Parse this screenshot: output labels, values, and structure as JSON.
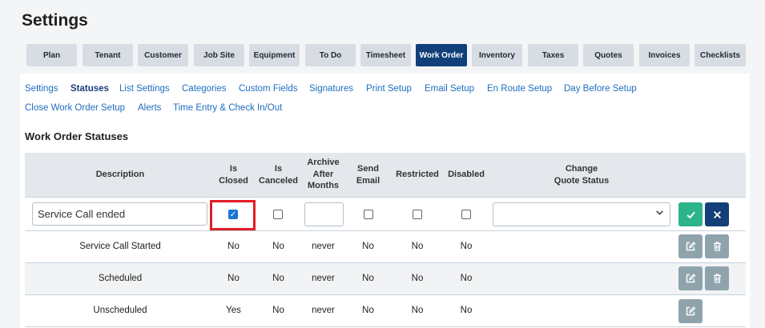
{
  "page": {
    "title": "Settings"
  },
  "tabs": [
    {
      "label": "Plan",
      "active": false
    },
    {
      "label": "Tenant",
      "active": false
    },
    {
      "label": "Customer",
      "active": false
    },
    {
      "label": "Job Site",
      "active": false
    },
    {
      "label": "Equipment",
      "active": false
    },
    {
      "label": "To Do",
      "active": false
    },
    {
      "label": "Timesheet",
      "active": false
    },
    {
      "label": "Work Order",
      "active": true
    },
    {
      "label": "Inventory",
      "active": false
    },
    {
      "label": "Taxes",
      "active": false
    },
    {
      "label": "Quotes",
      "active": false
    },
    {
      "label": "Invoices",
      "active": false
    },
    {
      "label": "Checklists",
      "active": false
    }
  ],
  "subnav": [
    {
      "label": "Settings",
      "active": false
    },
    {
      "label": "Statuses",
      "active": true
    },
    {
      "label": "List Settings",
      "active": false
    },
    {
      "label": "Categories",
      "active": false
    },
    {
      "label": "Custom Fields",
      "active": false
    },
    {
      "label": "Signatures",
      "active": false
    },
    {
      "label": "Print Setup",
      "active": false
    },
    {
      "label": "Email Setup",
      "active": false
    },
    {
      "label": "En Route Setup",
      "active": false
    },
    {
      "label": "Day Before Setup",
      "active": false
    },
    {
      "label": "Close Work Order Setup",
      "active": false
    },
    {
      "label": "Alerts",
      "active": false
    },
    {
      "label": "Time Entry & Check In/Out",
      "active": false
    }
  ],
  "section": {
    "title": "Work Order Statuses"
  },
  "table": {
    "headers": {
      "description": "Description",
      "is_closed": [
        "Is",
        "Closed"
      ],
      "is_canceled": [
        "Is",
        "Canceled"
      ],
      "archive": [
        "Archive",
        "After",
        "Months"
      ],
      "send_email": [
        "Send",
        "Email"
      ],
      "restricted": "Restricted",
      "disabled": "Disabled",
      "change_quote": [
        "Change",
        "Quote Status"
      ]
    },
    "edit_row": {
      "description": "Service Call ended",
      "is_closed": true,
      "is_canceled": false,
      "archive_after_months": "",
      "send_email": false,
      "restricted": false,
      "disabled": false,
      "change_quote_status": ""
    },
    "rows": [
      {
        "description": "Service Call Started",
        "is_closed": "No",
        "is_canceled": "No",
        "archive": "never",
        "send_email": "No",
        "restricted": "No",
        "disabled": "No",
        "deletable": true
      },
      {
        "description": "Scheduled",
        "is_closed": "No",
        "is_canceled": "No",
        "archive": "never",
        "send_email": "No",
        "restricted": "No",
        "disabled": "No",
        "deletable": true
      },
      {
        "description": "Unscheduled",
        "is_closed": "Yes",
        "is_canceled": "No",
        "archive": "never",
        "send_email": "No",
        "restricted": "No",
        "disabled": "No",
        "deletable": false
      }
    ]
  },
  "icons": {
    "save": "check-icon",
    "cancel": "close-icon",
    "edit": "edit-icon",
    "delete": "trash-icon",
    "select": "chevron-down-icon"
  },
  "colors": {
    "active_tab": "#103f7a",
    "save_button": "#2bb38a",
    "cancel_button": "#143f7a",
    "highlight": "#e11d26",
    "link": "#1e6ec0"
  }
}
